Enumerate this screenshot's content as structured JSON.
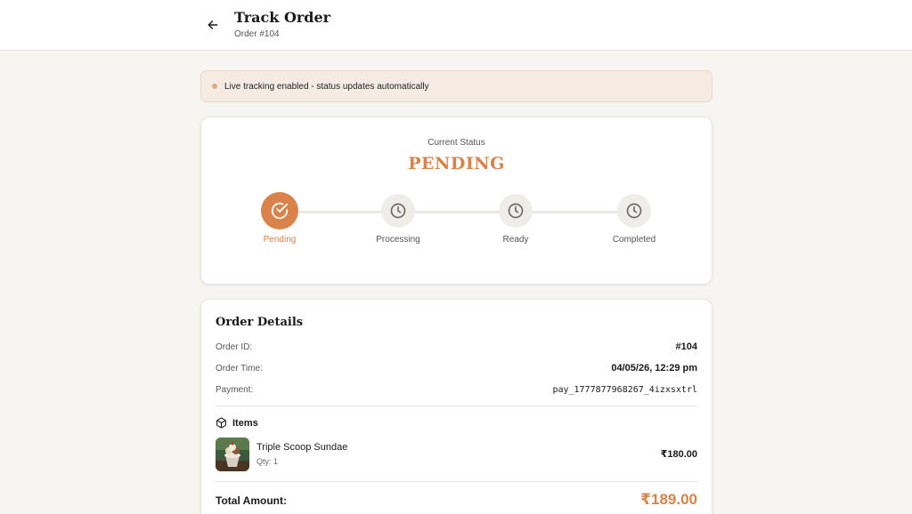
{
  "header": {
    "title": "Track Order",
    "subtitle": "Order #104"
  },
  "banner": {
    "text": "Live tracking enabled - status updates automatically"
  },
  "status": {
    "label": "Current Status",
    "value": "PENDING",
    "steps": [
      {
        "label": "Pending",
        "icon": "check-circle-icon",
        "active": true
      },
      {
        "label": "Processing",
        "icon": "clock-icon",
        "active": false
      },
      {
        "label": "Ready",
        "icon": "clock-icon",
        "active": false
      },
      {
        "label": "Completed",
        "icon": "clock-icon",
        "active": false
      }
    ]
  },
  "details": {
    "title": "Order Details",
    "order_id_label": "Order ID:",
    "order_id": "#104",
    "order_time_label": "Order Time:",
    "order_time": "04/05/26, 12:29 pm",
    "payment_label": "Payment:",
    "payment": "pay_1777877968267_4izxsxtrl",
    "items_title": "Items",
    "items": [
      {
        "name": "Triple Scoop Sundae",
        "qty": "Qty: 1",
        "price": "₹180.00"
      }
    ],
    "total_label": "Total Amount:",
    "total": "₹189.00"
  },
  "colors": {
    "accent": "#d9824a",
    "banner_bg": "#f6ebe2",
    "page_bg": "#f7f5f2"
  }
}
